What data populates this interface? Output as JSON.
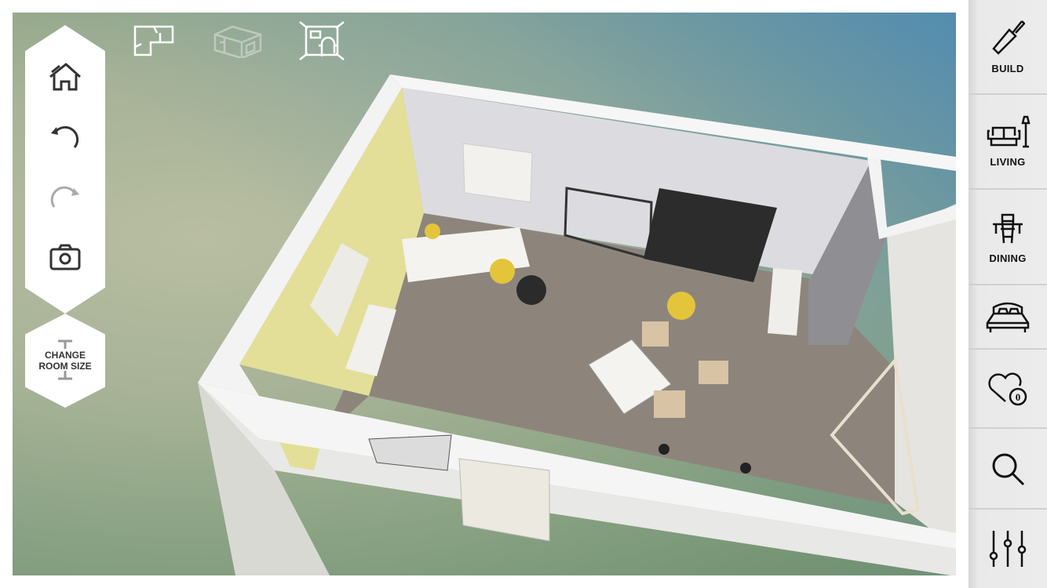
{
  "toolbar_left": {
    "items": [
      {
        "icon": "home-view-icon"
      },
      {
        "icon": "undo-icon"
      },
      {
        "icon": "redo-icon",
        "disabled": true
      },
      {
        "icon": "camera-icon"
      }
    ],
    "change_room_size": {
      "line1": "CHANGE",
      "line2": "ROOM SIZE"
    }
  },
  "view_modes": [
    {
      "icon": "floorplan-2d-icon",
      "active": false
    },
    {
      "icon": "3d-view-icon",
      "active": true
    },
    {
      "icon": "room-furnish-view-icon",
      "active": false
    }
  ],
  "sidebar": {
    "items": [
      {
        "label": "BUILD",
        "icon": "trowel-icon"
      },
      {
        "label": "LIVING",
        "icon": "sofa-lamp-icon"
      },
      {
        "label": "DINING",
        "icon": "dining-table-icon"
      },
      {
        "label": "",
        "icon": "bed-icon"
      },
      {
        "label": "",
        "icon": "heart-favorites-icon",
        "badge": "0"
      },
      {
        "label": "",
        "icon": "search-icon"
      },
      {
        "label": "",
        "icon": "sliders-settings-icon"
      }
    ]
  },
  "colors": {
    "accent_wall": "#e3df98",
    "floor": "#8d857c",
    "sidebar_bg": "#e9e9e9"
  }
}
